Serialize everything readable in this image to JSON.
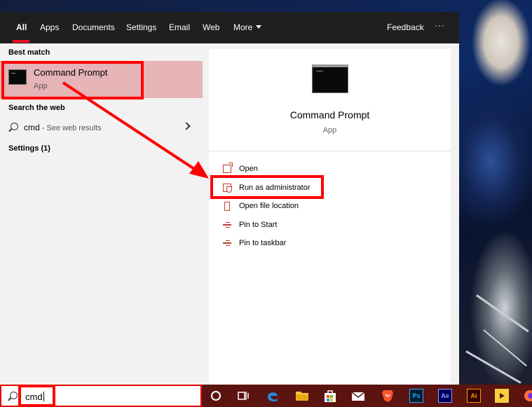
{
  "tabs": [
    {
      "label": "All",
      "active": true
    },
    {
      "label": "Apps"
    },
    {
      "label": "Documents"
    },
    {
      "label": "Settings"
    },
    {
      "label": "Email"
    },
    {
      "label": "Web"
    },
    {
      "label": "More"
    }
  ],
  "header_right": {
    "feedback": "Feedback",
    "more_options": "···"
  },
  "left": {
    "best_match_heading": "Best match",
    "best_match": {
      "title": "Command Prompt",
      "subtitle": "App"
    },
    "search_web_heading": "Search the web",
    "web_result": {
      "query": "cmd",
      "suffix": " - See web results"
    },
    "settings_heading": "Settings (1)"
  },
  "right": {
    "title": "Command Prompt",
    "subtitle": "App",
    "actions": [
      {
        "label": "Open",
        "icon": "open-icon"
      },
      {
        "label": "Run as administrator",
        "icon": "shield-icon"
      },
      {
        "label": "Open file location",
        "icon": "folder-icon"
      },
      {
        "label": "Pin to Start",
        "icon": "pin-icon"
      },
      {
        "label": "Pin to taskbar",
        "icon": "pin-icon"
      }
    ]
  },
  "taskbar": {
    "search_value": "cmd",
    "icons": [
      "cortana-icon",
      "task-view-icon",
      "edge-icon",
      "file-explorer-icon",
      "store-icon",
      "mail-icon",
      "brave-icon",
      "photoshop-icon",
      "after-effects-icon",
      "illustrator-icon",
      "potplayer-icon",
      "firefox-icon"
    ],
    "icon_labels": {
      "photoshop": "Ps",
      "after_effects": "Ae",
      "illustrator": "Ai"
    }
  },
  "colors": {
    "accent": "#e81123",
    "annotation": "#ff0000",
    "highlight_bg": "#e6b3b7",
    "taskbar": "#5b1410"
  }
}
